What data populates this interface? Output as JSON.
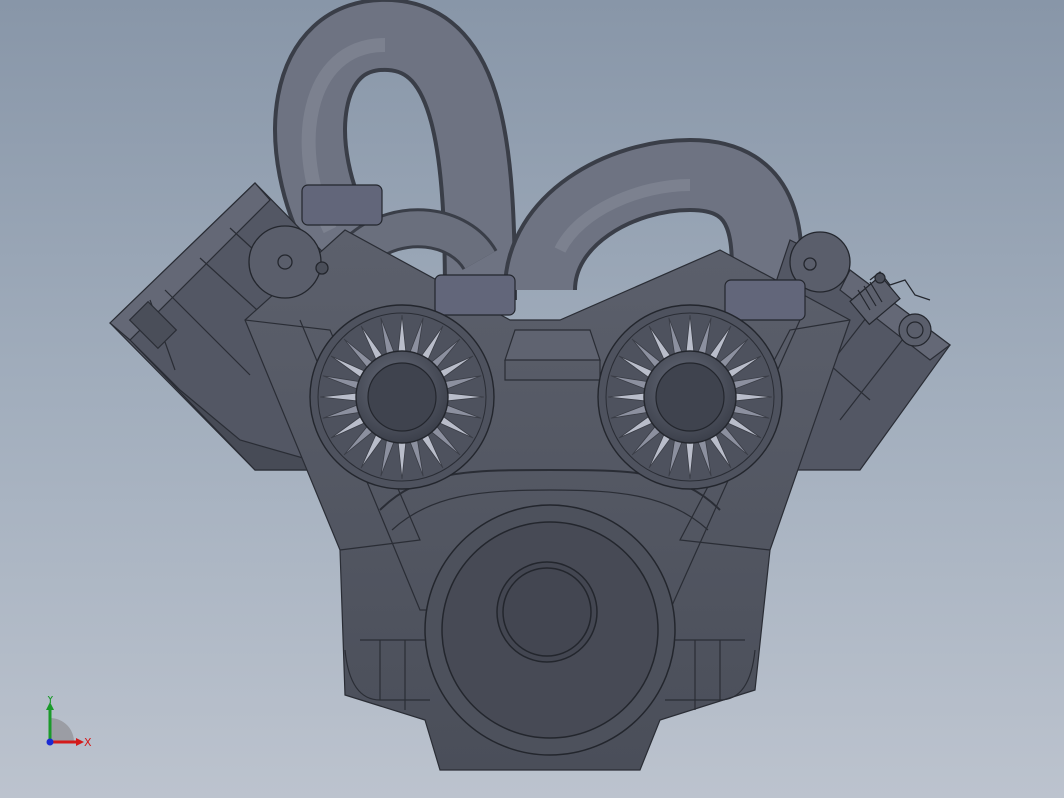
{
  "viewport": {
    "background_top": "#8896a8",
    "background_bottom": "#bcc3ce",
    "model_color": "#5b5f6c"
  },
  "triad": {
    "x_label": "X",
    "y_label": "Y",
    "x_color": "#d41a1a",
    "y_color": "#1a9a2a",
    "z_color": "#1a2ad4"
  },
  "model": {
    "name_icon": "v-engine-model",
    "pulley_count": 2,
    "fan_blades_per_pulley": 24
  }
}
